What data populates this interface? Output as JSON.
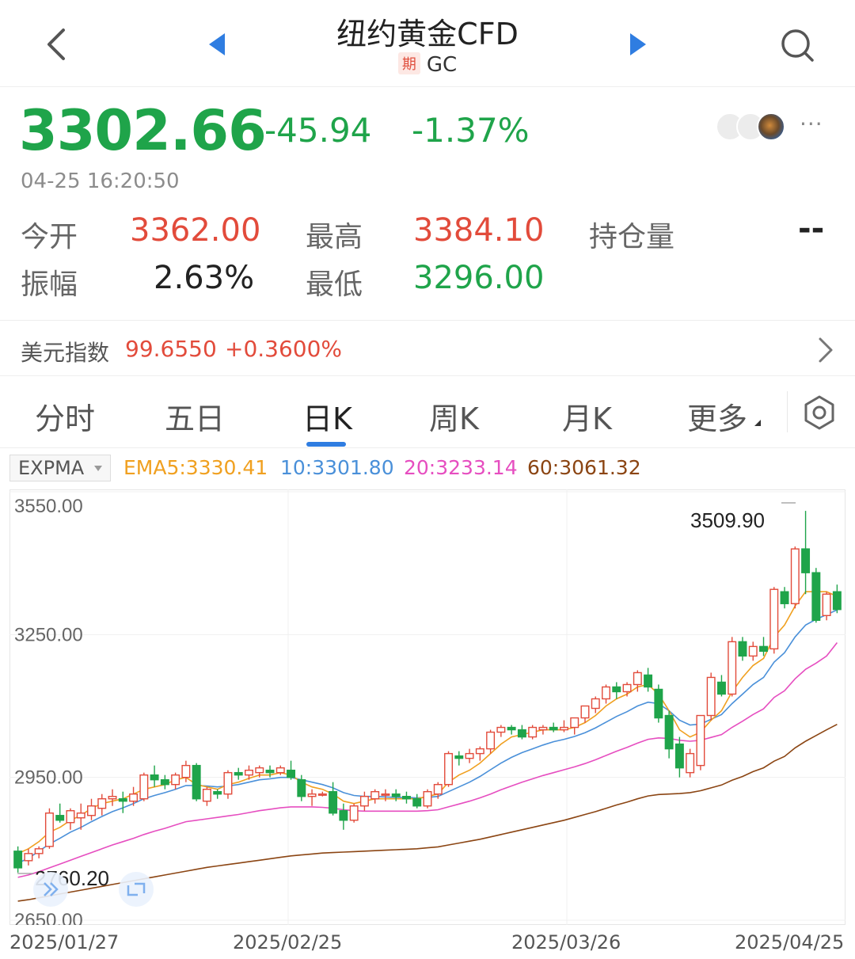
{
  "header": {
    "title": "纽约黄金CFD",
    "badge": "期",
    "symbol": "GC"
  },
  "quote": {
    "price": "3302.66",
    "change": "-45.94",
    "change_pct": "-1.37%",
    "time": "04-25 16:20:50",
    "more": "···"
  },
  "stats": {
    "open_label": "今开",
    "open": "3362.00",
    "high_label": "最高",
    "high": "3384.10",
    "oi_label": "持仓量",
    "oi": "--",
    "amp_label": "振幅",
    "amp": "2.63%",
    "low_label": "最低",
    "low": "3296.00"
  },
  "dxy": {
    "label": "美元指数",
    "value": "99.6550",
    "change": "+0.3600%"
  },
  "tabs": [
    "分时",
    "五日",
    "日K",
    "周K",
    "月K",
    "更多"
  ],
  "active_tab": "日K",
  "indicators": {
    "selector": "EXPMA",
    "ema5": "EMA5:3330.41",
    "ema10": "10:3301.80",
    "ema20": "20:3233.14",
    "ema60": "60:3061.32"
  },
  "colors": {
    "up": "#e24b3b",
    "down": "#1fa44a",
    "ema5": "#f0a020",
    "ema10": "#4a90d9",
    "ema20": "#e64ec0",
    "ema60": "#8b4513",
    "accent": "#2f7de1"
  },
  "chart_data": {
    "type": "candlestick",
    "y_ticks": [
      "3550.00",
      "3250.00",
      "2950.00",
      "2650.00"
    ],
    "ylim": [
      2640,
      3555
    ],
    "x_ticks": [
      "2025/01/27",
      "2025/02/25",
      "2025/03/26",
      "2025/04/25"
    ],
    "annotations": {
      "max": "3509.90",
      "min": "2760.20"
    },
    "ohlc": [
      [
        2795,
        2805,
        2750,
        2760
      ],
      [
        2775,
        2800,
        2765,
        2790
      ],
      [
        2790,
        2805,
        2780,
        2800
      ],
      [
        2805,
        2885,
        2800,
        2875
      ],
      [
        2870,
        2895,
        2855,
        2860
      ],
      [
        2855,
        2885,
        2840,
        2880
      ],
      [
        2865,
        2895,
        2840,
        2875
      ],
      [
        2870,
        2905,
        2860,
        2890
      ],
      [
        2885,
        2915,
        2870,
        2905
      ],
      [
        2905,
        2925,
        2890,
        2910
      ],
      [
        2905,
        2920,
        2875,
        2900
      ],
      [
        2900,
        2930,
        2890,
        2915
      ],
      [
        2905,
        2960,
        2900,
        2955
      ],
      [
        2955,
        2975,
        2930,
        2945
      ],
      [
        2945,
        2955,
        2925,
        2935
      ],
      [
        2935,
        2960,
        2925,
        2955
      ],
      [
        2950,
        2985,
        2940,
        2975
      ],
      [
        2975,
        2980,
        2900,
        2905
      ],
      [
        2900,
        2930,
        2890,
        2925
      ],
      [
        2920,
        2925,
        2905,
        2915
      ],
      [
        2915,
        2965,
        2905,
        2960
      ],
      [
        2960,
        2970,
        2945,
        2955
      ],
      [
        2955,
        2975,
        2945,
        2965
      ],
      [
        2960,
        2975,
        2950,
        2970
      ],
      [
        2965,
        2975,
        2950,
        2960
      ],
      [
        2960,
        2975,
        2955,
        2970
      ],
      [
        2965,
        2985,
        2945,
        2950
      ],
      [
        2945,
        2955,
        2900,
        2910
      ],
      [
        2910,
        2925,
        2890,
        2915
      ],
      [
        2915,
        2920,
        2910,
        2915
      ],
      [
        2920,
        2940,
        2870,
        2875
      ],
      [
        2880,
        2895,
        2840,
        2860
      ],
      [
        2860,
        2895,
        2855,
        2890
      ],
      [
        2890,
        2920,
        2880,
        2910
      ],
      [
        2905,
        2925,
        2895,
        2920
      ],
      [
        2915,
        2925,
        2900,
        2915
      ],
      [
        2915,
        2925,
        2900,
        2910
      ],
      [
        2910,
        2920,
        2895,
        2905
      ],
      [
        2905,
        2915,
        2885,
        2890
      ],
      [
        2890,
        2925,
        2885,
        2920
      ],
      [
        2915,
        2940,
        2905,
        2935
      ],
      [
        2935,
        3005,
        2930,
        3000
      ],
      [
        2995,
        3005,
        2975,
        2990
      ],
      [
        2990,
        3010,
        2980,
        3000
      ],
      [
        3000,
        3015,
        2985,
        3010
      ],
      [
        3010,
        3050,
        3000,
        3045
      ],
      [
        3045,
        3060,
        3035,
        3055
      ],
      [
        3055,
        3060,
        3040,
        3050
      ],
      [
        3050,
        3060,
        3030,
        3035
      ],
      [
        3035,
        3060,
        3030,
        3055
      ],
      [
        3050,
        3060,
        3040,
        3055
      ],
      [
        3055,
        3065,
        3045,
        3050
      ],
      [
        3050,
        3070,
        3045,
        3055
      ],
      [
        3055,
        3075,
        3040,
        3075
      ],
      [
        3075,
        3100,
        3065,
        3100
      ],
      [
        3095,
        3120,
        3085,
        3115
      ],
      [
        3115,
        3145,
        3105,
        3140
      ],
      [
        3140,
        3150,
        3115,
        3130
      ],
      [
        3130,
        3150,
        3120,
        3145
      ],
      [
        3145,
        3175,
        3130,
        3170
      ],
      [
        3165,
        3180,
        3130,
        3140
      ],
      [
        3135,
        3145,
        3065,
        3075
      ],
      [
        3080,
        3090,
        2990,
        3010
      ],
      [
        3020,
        3035,
        2950,
        2970
      ],
      [
        2960,
        3010,
        2950,
        3000
      ],
      [
        2975,
        3080,
        2965,
        3080
      ],
      [
        3080,
        3170,
        3070,
        3160
      ],
      [
        3150,
        3165,
        3120,
        3125
      ],
      [
        3125,
        3245,
        3120,
        3235
      ],
      [
        3235,
        3245,
        3195,
        3205
      ],
      [
        3205,
        3235,
        3195,
        3225
      ],
      [
        3225,
        3245,
        3205,
        3215
      ],
      [
        3220,
        3350,
        3210,
        3345
      ],
      [
        3340,
        3350,
        3305,
        3315
      ],
      [
        3315,
        3435,
        3305,
        3430
      ],
      [
        3430,
        3509.9,
        3335,
        3380
      ],
      [
        3380,
        3390,
        3275,
        3280
      ],
      [
        3290,
        3340,
        3280,
        3335
      ],
      [
        3340,
        3355,
        3295,
        3302.66
      ]
    ],
    "ema5": [
      2790,
      2800,
      2815,
      2835,
      2845,
      2860,
      2870,
      2885,
      2895,
      2900,
      2905,
      2915,
      2925,
      2930,
      2935,
      2945,
      2950,
      2935,
      2930,
      2925,
      2935,
      2940,
      2948,
      2955,
      2955,
      2960,
      2955,
      2940,
      2930,
      2925,
      2915,
      2900,
      2895,
      2900,
      2905,
      2905,
      2905,
      2905,
      2905,
      2910,
      2915,
      2940,
      2955,
      2965,
      2980,
      3000,
      3020,
      3035,
      3040,
      3045,
      3050,
      3050,
      3050,
      3055,
      3065,
      3080,
      3100,
      3115,
      3125,
      3140,
      3145,
      3125,
      3090,
      3050,
      3035,
      3045,
      3070,
      3090,
      3130,
      3160,
      3185,
      3200,
      3245,
      3270,
      3310,
      3340,
      3340,
      3340,
      3330.41
    ],
    "ema10": [
      2770,
      2780,
      2795,
      2810,
      2822,
      2835,
      2845,
      2857,
      2868,
      2878,
      2886,
      2895,
      2905,
      2912,
      2918,
      2925,
      2933,
      2933,
      2932,
      2930,
      2932,
      2935,
      2940,
      2945,
      2947,
      2950,
      2950,
      2945,
      2940,
      2935,
      2928,
      2918,
      2912,
      2910,
      2910,
      2909,
      2908,
      2908,
      2907,
      2908,
      2910,
      2920,
      2930,
      2940,
      2952,
      2966,
      2980,
      2992,
      3002,
      3010,
      3018,
      3025,
      3030,
      3036,
      3044,
      3054,
      3066,
      3078,
      3088,
      3100,
      3108,
      3105,
      3090,
      3070,
      3060,
      3062,
      3072,
      3082,
      3105,
      3125,
      3145,
      3160,
      3192,
      3212,
      3245,
      3270,
      3282,
      3292,
      3301.8
    ],
    "ema20": [
      2740,
      2745,
      2752,
      2760,
      2768,
      2776,
      2784,
      2792,
      2800,
      2808,
      2815,
      2822,
      2830,
      2837,
      2843,
      2850,
      2857,
      2860,
      2863,
      2866,
      2869,
      2872,
      2876,
      2880,
      2883,
      2886,
      2888,
      2888,
      2888,
      2887,
      2885,
      2882,
      2880,
      2879,
      2879,
      2879,
      2879,
      2879,
      2879,
      2880,
      2882,
      2888,
      2894,
      2900,
      2907,
      2915,
      2924,
      2932,
      2940,
      2947,
      2954,
      2960,
      2966,
      2972,
      2979,
      2987,
      2996,
      3005,
      3013,
      3022,
      3030,
      3033,
      3032,
      3028,
      3026,
      3028,
      3034,
      3040,
      3055,
      3068,
      3082,
      3094,
      3118,
      3132,
      3157,
      3177,
      3190,
      3205,
      3233.14
    ],
    "ema60": [
      2690,
      2693,
      2697,
      2701,
      2705,
      2709,
      2713,
      2717,
      2721,
      2725,
      2729,
      2733,
      2737,
      2741,
      2745,
      2749,
      2753,
      2757,
      2761,
      2764,
      2767,
      2770,
      2773,
      2776,
      2779,
      2782,
      2785,
      2787,
      2789,
      2791,
      2792,
      2793,
      2794,
      2795,
      2796,
      2797,
      2798,
      2799,
      2800,
      2802,
      2804,
      2808,
      2812,
      2816,
      2820,
      2825,
      2830,
      2835,
      2840,
      2845,
      2850,
      2855,
      2860,
      2866,
      2872,
      2878,
      2885,
      2892,
      2898,
      2905,
      2911,
      2914,
      2915,
      2916,
      2918,
      2922,
      2928,
      2934,
      2944,
      2952,
      2962,
      2970,
      2984,
      2994,
      3012,
      3026,
      3038,
      3050,
      3061.32
    ]
  }
}
